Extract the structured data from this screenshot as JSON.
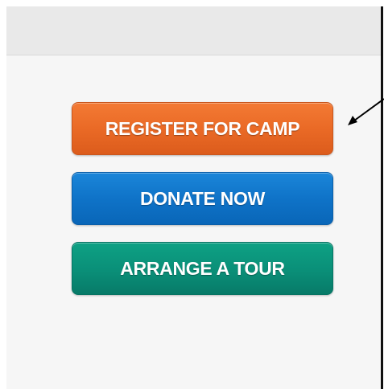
{
  "buttons": {
    "register": {
      "label": "REGISTER FOR CAMP",
      "color": "#ea6a26"
    },
    "donate": {
      "label": "DONATE NOW",
      "color": "#0f73c8"
    },
    "tour": {
      "label": "ARRANGE A TOUR",
      "color": "#0a8f78"
    }
  },
  "annotation": {
    "icon": "arrow-icon"
  }
}
